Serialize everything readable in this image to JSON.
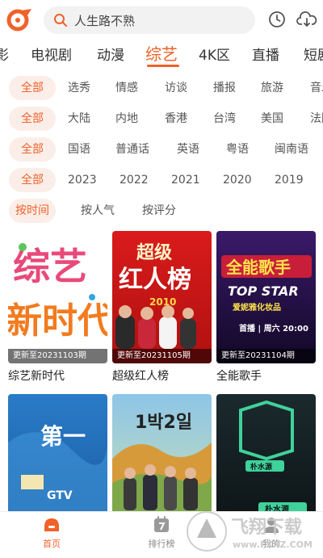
{
  "search": {
    "placeholder": "人生路不熟"
  },
  "tabs": [
    "影",
    "电视剧",
    "动漫",
    "综艺",
    "4K区",
    "直播",
    "短剧"
  ],
  "active_tab": "综艺",
  "filters": [
    {
      "items": [
        "全部",
        "选秀",
        "情感",
        "访谈",
        "播报",
        "旅游",
        "音乐"
      ]
    },
    {
      "items": [
        "全部",
        "大陆",
        "内地",
        "香港",
        "台湾",
        "美国",
        "法国"
      ]
    },
    {
      "items": [
        "全部",
        "国语",
        "普通话",
        "英语",
        "粤语",
        "闽南语"
      ]
    },
    {
      "items": [
        "全部",
        "2023",
        "2022",
        "2021",
        "2020",
        "2019"
      ]
    },
    {
      "items": [
        "按时间",
        "按人气",
        "按评分"
      ]
    }
  ],
  "cards": [
    {
      "title": "综艺新时代",
      "badge": "更新至20231103期",
      "poster_text": [
        "综艺",
        "新时代"
      ]
    },
    {
      "title": "超级红人榜",
      "badge": "更新至20231105期",
      "poster_text": [
        "超级",
        "红人榜",
        "2010"
      ]
    },
    {
      "title": "全能歌手",
      "badge": "更新至20231104期",
      "poster_text": [
        "全能歌手",
        "TOP STAR",
        "爱妮雅化妆品",
        "首播 | 周六 20:00"
      ]
    },
    {
      "title": "",
      "badge": "",
      "poster_text": [
        "第一",
        "GTV"
      ]
    },
    {
      "title": "",
      "badge": "",
      "poster_text": [
        "1박2일"
      ]
    },
    {
      "title": "",
      "badge": "",
      "poster_text": [
        "朴水源",
        "朴水源"
      ]
    }
  ],
  "bottom_nav": [
    {
      "label": "首页",
      "icon": "home-icon"
    },
    {
      "label": "排行榜",
      "icon": "ranking-icon"
    },
    {
      "label": "我的",
      "icon": "profile-icon"
    }
  ],
  "watermark": {
    "text": "飞翔下载",
    "sub": "www.FXXZ.COM"
  },
  "colors": {
    "accent": "#f0622a",
    "chip_bg": "#fbeee8"
  }
}
